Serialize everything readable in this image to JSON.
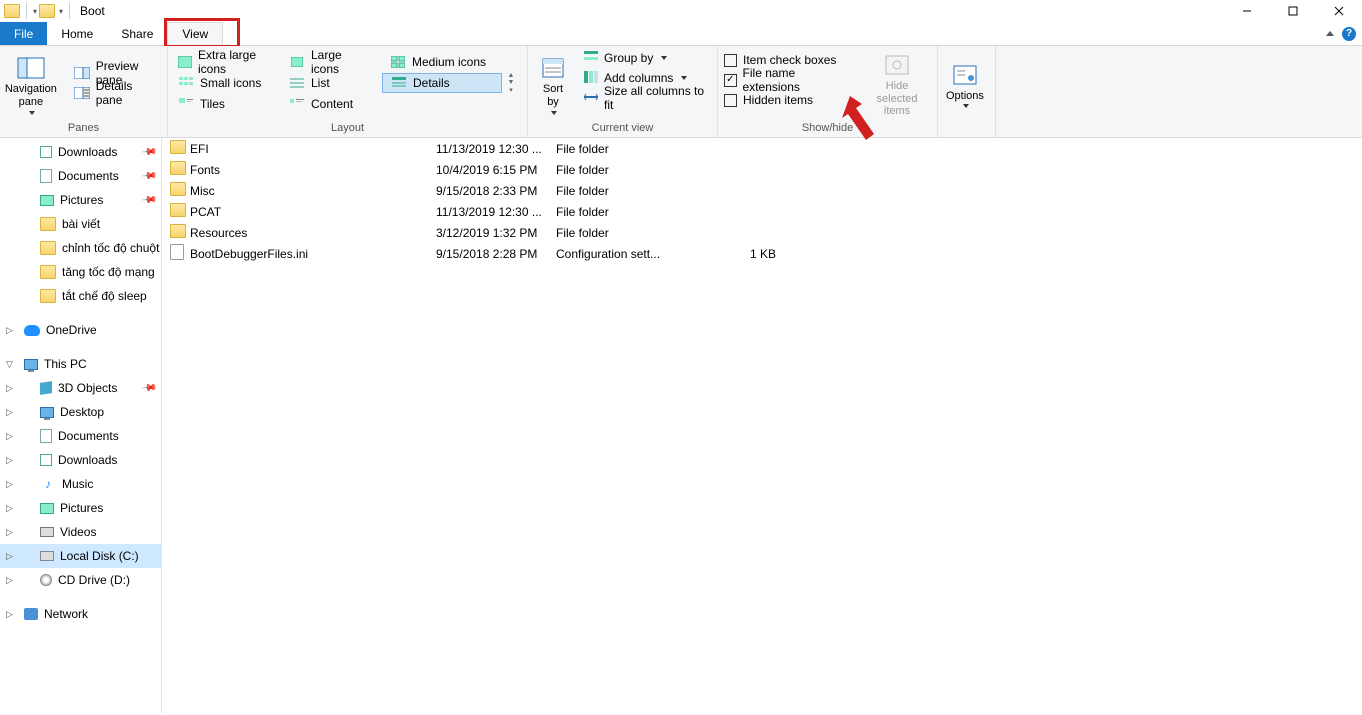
{
  "window": {
    "title": "Boot"
  },
  "menu": {
    "file": "File",
    "home": "Home",
    "share": "Share",
    "view": "View"
  },
  "ribbon": {
    "panes": {
      "nav": "Navigation\npane",
      "preview": "Preview pane",
      "details": "Details pane",
      "label": "Panes"
    },
    "layout": {
      "xl": "Extra large icons",
      "lg": "Large icons",
      "md": "Medium icons",
      "sm": "Small icons",
      "list": "List",
      "details": "Details",
      "tiles": "Tiles",
      "content": "Content",
      "label": "Layout"
    },
    "currentview": {
      "sort": "Sort\nby",
      "group": "Group by",
      "addcols": "Add columns",
      "sizecols": "Size all columns to fit",
      "label": "Current view"
    },
    "showhide": {
      "itemchk": "Item check boxes",
      "ext": "File name extensions",
      "hidden": "Hidden items",
      "hidesel": "Hide selected\nitems",
      "label": "Show/hide"
    },
    "options": "Options"
  },
  "nav": {
    "downloads": "Downloads",
    "documents": "Documents",
    "pictures": "Pictures",
    "baiviet": "bài viết",
    "chinhtoc": "chỉnh tốc độ chuột",
    "tangtoc": "tăng tốc độ mạng",
    "tatche": "tắt chế độ sleep",
    "onedrive": "OneDrive",
    "thispc": "This PC",
    "obj3d": "3D Objects",
    "desktop": "Desktop",
    "documents2": "Documents",
    "downloads2": "Downloads",
    "music": "Music",
    "pictures2": "Pictures",
    "videos": "Videos",
    "localdisk": "Local Disk (C:)",
    "cddrive": "CD Drive (D:)",
    "network": "Network"
  },
  "files": [
    {
      "name": "EFI",
      "date": "11/13/2019 12:30 ...",
      "type": "File folder",
      "size": "",
      "icon": "folder"
    },
    {
      "name": "Fonts",
      "date": "10/4/2019 6:15 PM",
      "type": "File folder",
      "size": "",
      "icon": "folder"
    },
    {
      "name": "Misc",
      "date": "9/15/2018 2:33 PM",
      "type": "File folder",
      "size": "",
      "icon": "folder"
    },
    {
      "name": "PCAT",
      "date": "11/13/2019 12:30 ...",
      "type": "File folder",
      "size": "",
      "icon": "folder"
    },
    {
      "name": "Resources",
      "date": "3/12/2019 1:32 PM",
      "type": "File folder",
      "size": "",
      "icon": "folder"
    },
    {
      "name": "BootDebuggerFiles.ini",
      "date": "9/15/2018 2:28 PM",
      "type": "Configuration sett...",
      "size": "1 KB",
      "icon": "file"
    }
  ]
}
